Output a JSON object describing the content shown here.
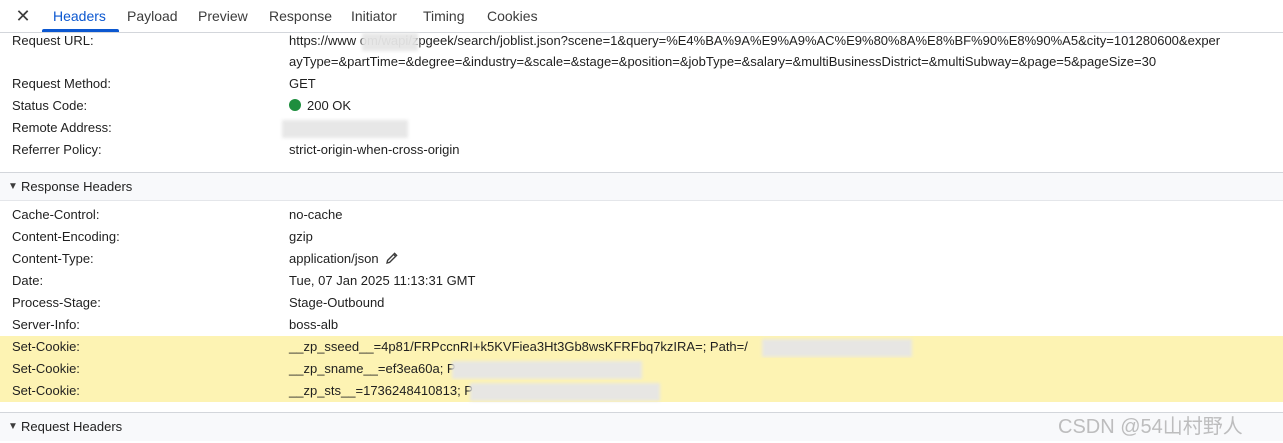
{
  "tabs": {
    "close_label": "✕",
    "items": [
      "Headers",
      "Payload",
      "Preview",
      "Response",
      "Initiator",
      "Timing",
      "Cookies"
    ],
    "active": "Headers"
  },
  "general": [
    {
      "key": "Request URL:",
      "value": "https://www                    om/wapi/zpgeek/search/joblist.json?scene=1&query=%E4%BA%9A%E9%A9%AC%E9%80%8A%E8%BF%90%E8%90%A5&city=101280600&exper"
    },
    {
      "key": "",
      "value": "ayType=&partTime=&degree=&industry=&scale=&stage=&position=&jobType=&salary=&multiBusinessDistrict=&multiSubway=&page=5&pageSize=30"
    },
    {
      "key": "Request Method:",
      "value": "GET"
    },
    {
      "key": "Status Code:",
      "value": "200 OK"
    },
    {
      "key": "Remote Address:",
      "value": ""
    },
    {
      "key": "Referrer Policy:",
      "value": "strict-origin-when-cross-origin"
    }
  ],
  "response_section": {
    "title": "Response Headers",
    "expanded": true
  },
  "response_headers": [
    {
      "key": "Cache-Control:",
      "value": "no-cache"
    },
    {
      "key": "Content-Encoding:",
      "value": "gzip"
    },
    {
      "key": "Content-Type:",
      "value": "application/json"
    },
    {
      "key": "Date:",
      "value": "Tue, 07 Jan 2025 11:13:31 GMT"
    },
    {
      "key": "Process-Stage:",
      "value": "Stage-Outbound"
    },
    {
      "key": "Server-Info:",
      "value": "boss-alb"
    },
    {
      "key": "Set-Cookie:",
      "value": "__zp_sseed__=4p81/FRPccnRI+k5KVFiea3Ht3Gb8wsKFRFbq7kzIRA=; Path=/"
    },
    {
      "key": "Set-Cookie:",
      "value": "__zp_sname__=ef3ea60a; P"
    },
    {
      "key": "Set-Cookie:",
      "value": "__zp_sts__=1736248410813; P"
    }
  ],
  "request_section": {
    "title": "Request Headers",
    "expanded": true
  },
  "status_color": "#1e8e3e",
  "highlight_color": "#fdf3b3",
  "accent_color": "#0b57d0",
  "watermark": "CSDN @54山村野人"
}
